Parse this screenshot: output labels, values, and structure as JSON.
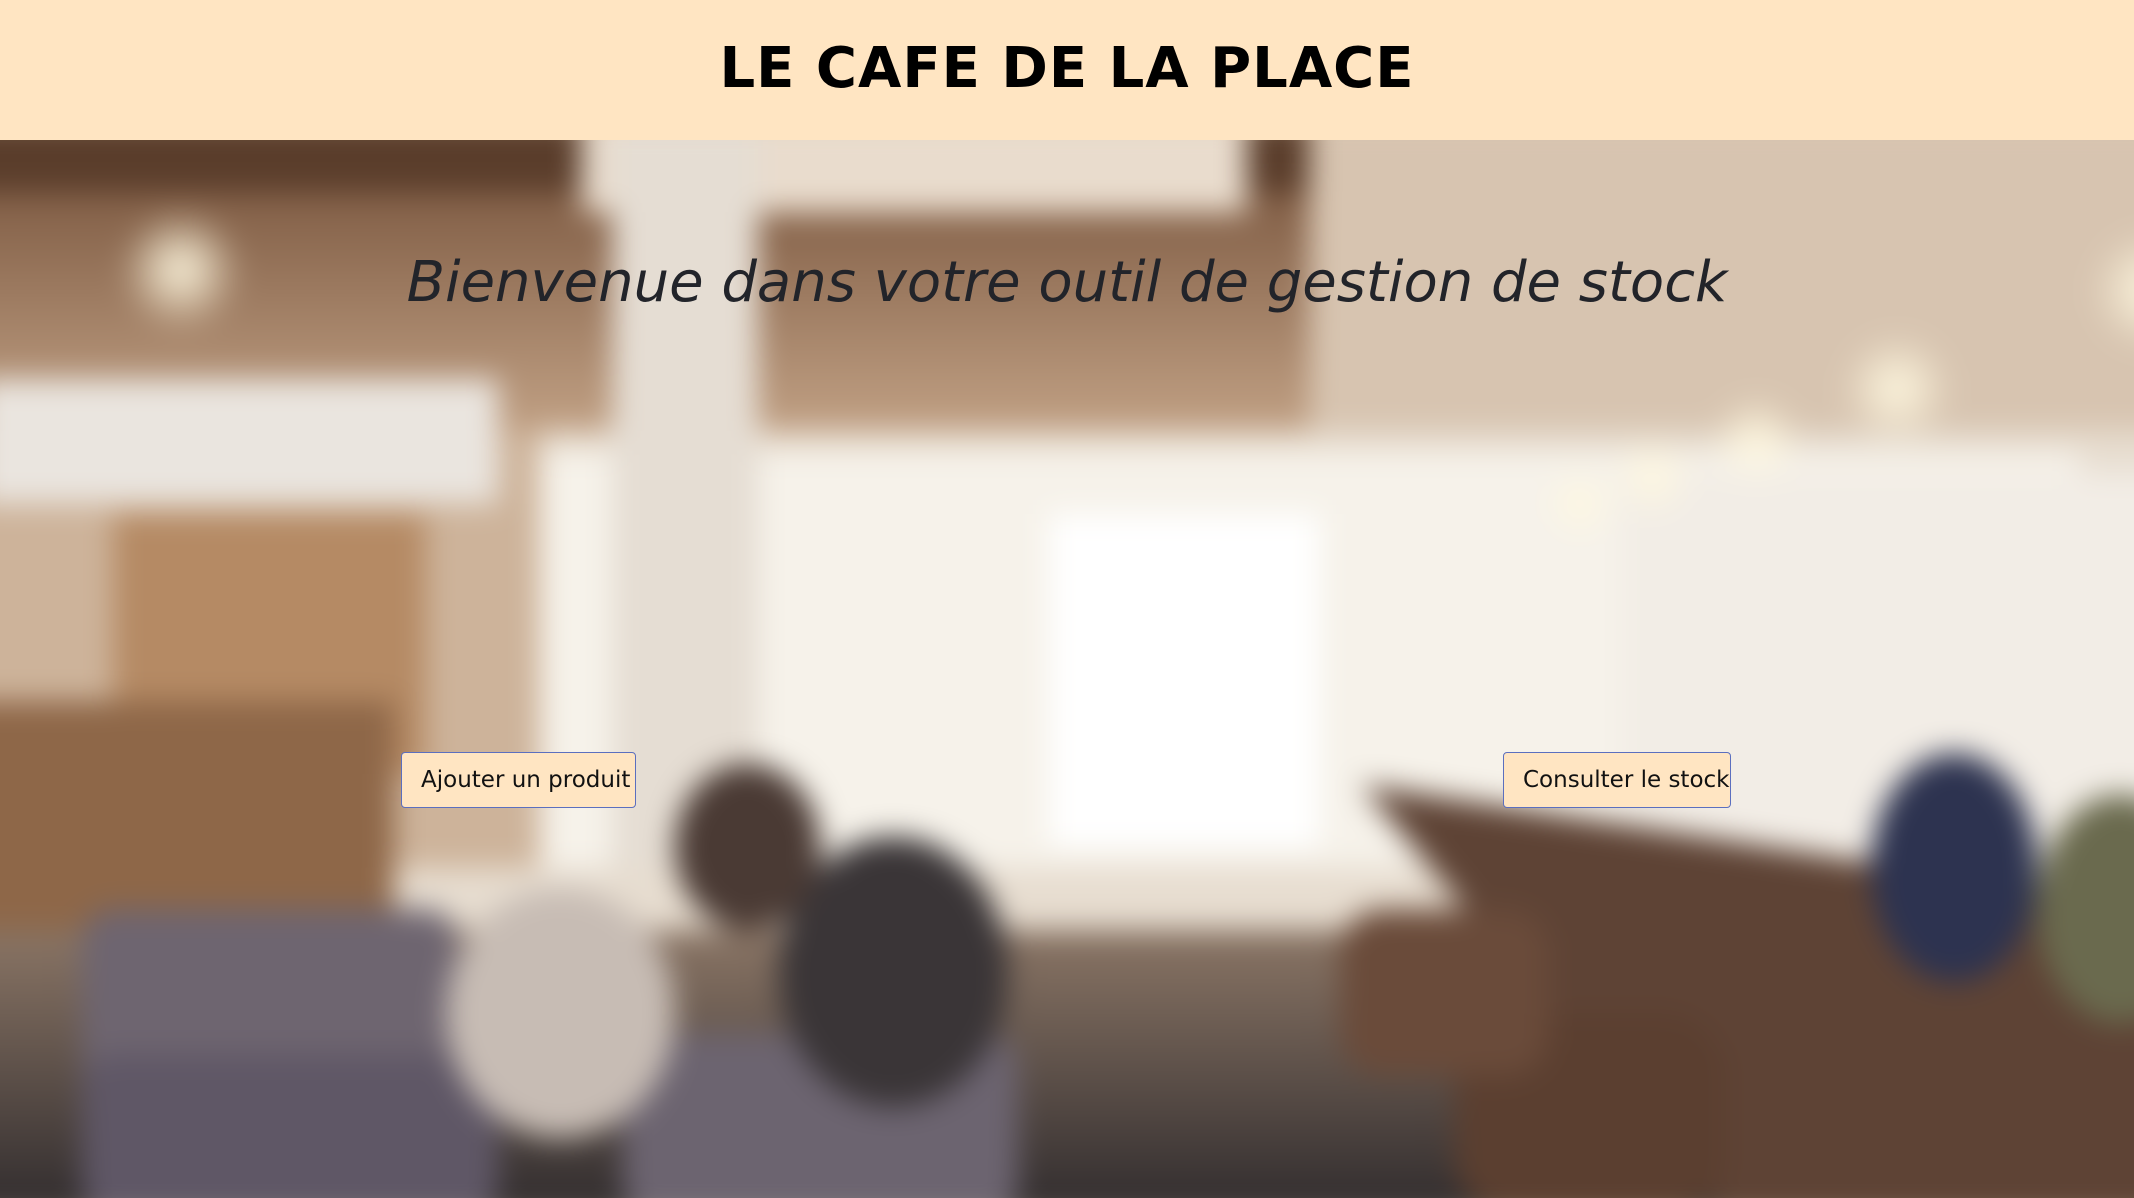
{
  "header": {
    "title": "LE CAFE DE LA PLACE",
    "background_color": "#ffe5c2"
  },
  "hero": {
    "welcome": "Bienvenue dans votre outil de gestion de stock",
    "background": "blurred-cafe-interior-photo"
  },
  "actions": {
    "add_product_label": "Ajouter un produit",
    "view_stock_label": "Consulter le stock",
    "button_background": "#ffe5c2",
    "button_border": "#5b6fbf"
  }
}
